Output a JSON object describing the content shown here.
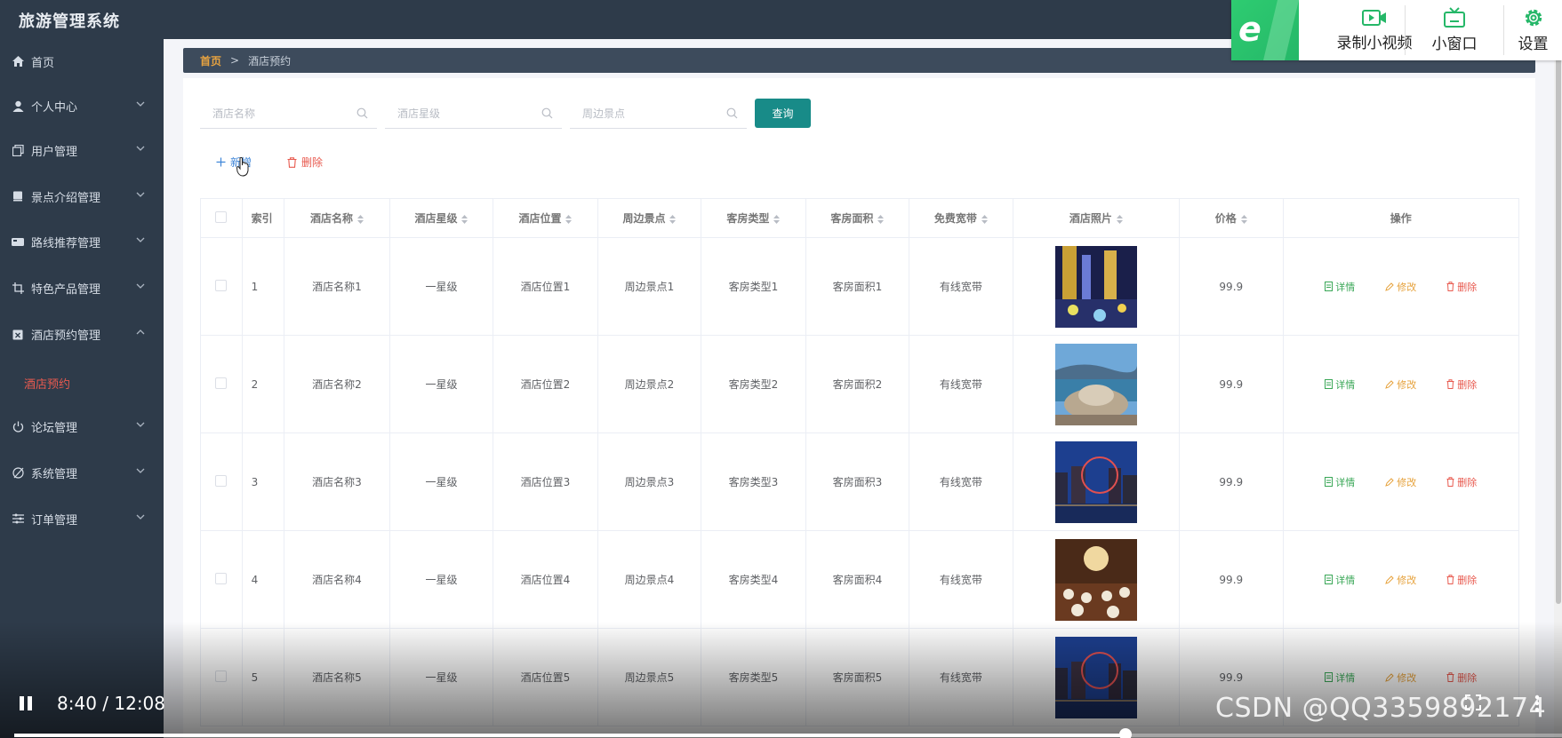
{
  "app": {
    "title": "旅游管理系统"
  },
  "sidebar": {
    "items": [
      {
        "label": "首页",
        "icon": "home-icon"
      },
      {
        "label": "个人中心",
        "icon": "user-icon"
      },
      {
        "label": "用户管理",
        "icon": "users-icon"
      },
      {
        "label": "景点介绍管理",
        "icon": "book-icon"
      },
      {
        "label": "路线推荐管理",
        "icon": "route-icon"
      },
      {
        "label": "特色产品管理",
        "icon": "crop-icon"
      },
      {
        "label": "酒店预约管理",
        "icon": "hotel-icon"
      },
      {
        "label": "论坛管理",
        "icon": "power-icon"
      },
      {
        "label": "系统管理",
        "icon": "system-icon"
      },
      {
        "label": "订单管理",
        "icon": "sliders-icon"
      }
    ],
    "active_sub": "酒店预约"
  },
  "breadcrumb": {
    "home": "首页",
    "sep": ">",
    "current": "酒店预约"
  },
  "search": {
    "name_placeholder": "酒店名称",
    "star_placeholder": "酒店星级",
    "spot_placeholder": "周边景点",
    "query_label": "查询"
  },
  "actions": {
    "add_label": "新增",
    "delete_label": "删除"
  },
  "table": {
    "headers": [
      "索引",
      "酒店名称",
      "酒店星级",
      "酒店位置",
      "周边景点",
      "客房类型",
      "客房面积",
      "免费宽带",
      "酒店照片",
      "价格",
      "操作"
    ],
    "rows": [
      {
        "index": "1",
        "name": "酒店名称1",
        "star": "一星级",
        "location": "酒店位置1",
        "spot": "周边景点1",
        "room_type": "客房类型1",
        "area": "客房面积1",
        "wifi": "有线宽带",
        "price": "99.9"
      },
      {
        "index": "2",
        "name": "酒店名称2",
        "star": "一星级",
        "location": "酒店位置2",
        "spot": "周边景点2",
        "room_type": "客房类型2",
        "area": "客房面积2",
        "wifi": "有线宽带",
        "price": "99.9"
      },
      {
        "index": "3",
        "name": "酒店名称3",
        "star": "一星级",
        "location": "酒店位置3",
        "spot": "周边景点3",
        "room_type": "客房类型3",
        "area": "客房面积3",
        "wifi": "有线宽带",
        "price": "99.9"
      },
      {
        "index": "4",
        "name": "酒店名称4",
        "star": "一星级",
        "location": "酒店位置4",
        "spot": "周边景点4",
        "room_type": "客房类型4",
        "area": "客房面积4",
        "wifi": "有线宽带",
        "price": "99.9"
      },
      {
        "index": "5",
        "name": "酒店名称5",
        "star": "一星级",
        "location": "酒店位置5",
        "spot": "周边景点5",
        "room_type": "客房类型5",
        "area": "客房面积5",
        "wifi": "有线宽带",
        "price": "99.9"
      }
    ],
    "ops": {
      "detail": "详情",
      "edit": "修改",
      "delete": "删除"
    }
  },
  "video_toolbar": {
    "record": "录制小视频",
    "mini": "小窗口",
    "settings": "设置"
  },
  "player": {
    "time": "8:40 / 12:08",
    "progress": 0.718,
    "watermark": "CSDN @QQ3359892174"
  },
  "colors": {
    "sidebar_bg": "#2e3b4a",
    "accent_teal": "#188b88",
    "active_red": "#e85a4f",
    "breadcrumb_home": "#e8a340"
  }
}
